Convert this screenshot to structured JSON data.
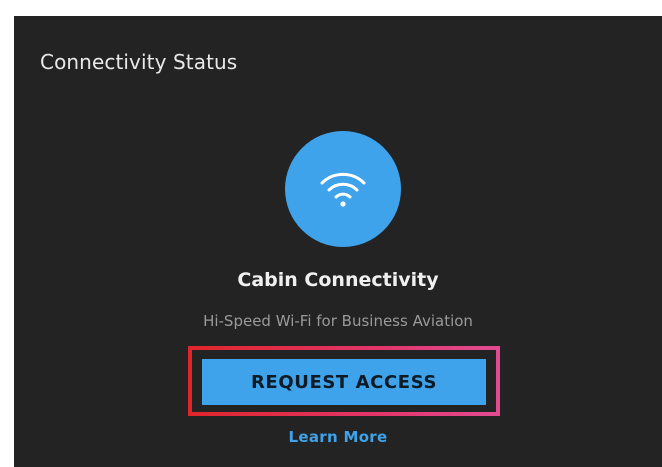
{
  "card": {
    "title": "Connectivity Status"
  },
  "product": {
    "icon": "wifi-icon",
    "title": "Cabin Connectivity",
    "subtitle": "Hi-Speed Wi-Fi for Business Aviation"
  },
  "actions": {
    "request_label": "REQUEST ACCESS",
    "learn_more_label": "Learn More"
  },
  "colors": {
    "card_background": "#232323",
    "accent": "#3ea3ea",
    "highlight_border": "#e2356a"
  }
}
